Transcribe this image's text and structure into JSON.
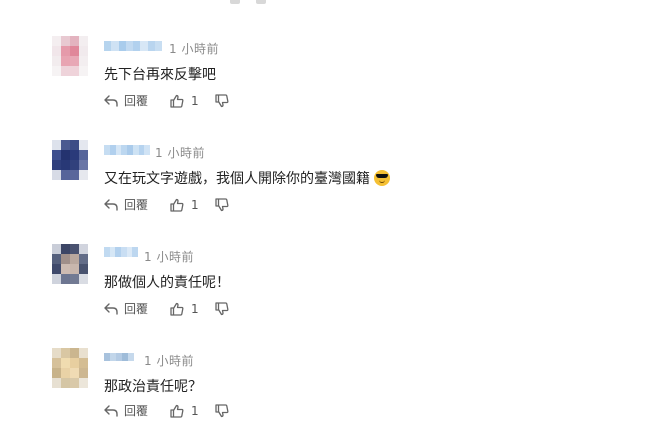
{
  "comments": [
    {
      "time": "1 小時前",
      "text": "先下台再來反擊吧",
      "emoji": "",
      "reply_label": "回覆",
      "like_count": "1",
      "avatar_colors": [
        "#f4eef0",
        "#e8c9d1",
        "#e3b3bf",
        "#f3eef0",
        "#f1e6ea",
        "#e59aaa",
        "#e0879a",
        "#f1eaed",
        "#f2ecee",
        "#e8a4b2",
        "#e8a8b6",
        "#f3eef0",
        "#f6f3f4",
        "#eed3da",
        "#efd3da",
        "#f6f3f4"
      ],
      "name_colors": [
        "#b6d4ee",
        "#cfe2f4",
        "#a9ccec",
        "#c2daf1",
        "#b2d1ee",
        "#d7e7f6",
        "#b9d5ef",
        "#c8def2"
      ]
    },
    {
      "time": "1 小時前",
      "text": "又在玩文字遊戲，我個人開除你的臺灣國籍",
      "emoji": "sunglasses-emoji",
      "reply_label": "回覆",
      "like_count": "1",
      "avatar_colors": [
        "#dde2ec",
        "#4a5a90",
        "#3d4d86",
        "#e4e7ef",
        "#3e4f8e",
        "#24336f",
        "#2a3a7a",
        "#56659a",
        "#2f3f7c",
        "#283876",
        "#31417c",
        "#6a76a6",
        "#d7dbe6",
        "#56649a",
        "#5a679b",
        "#e6e8ee"
      ],
      "name_colors": [
        "#c6ddf2",
        "#b1d0ee",
        "#d5e6f6",
        "#bcd7f0",
        "#aacbeb",
        "#cde2f4",
        "#b6d3ef",
        "#d0e3f5"
      ]
    },
    {
      "time": "1 小時前",
      "text": "那做個人的責任呢！",
      "emoji": "",
      "reply_label": "回覆",
      "like_count": "1",
      "avatar_colors": [
        "#c9cdd8",
        "#3c4566",
        "#4a5270",
        "#d1d4de",
        "#55607d",
        "#a08f8a",
        "#b9a79e",
        "#636d88",
        "#3f4a6c",
        "#cdbbb2",
        "#c8b6ad",
        "#49536f",
        "#cfd3dd",
        "#6d7691",
        "#727a93",
        "#d9dce3"
      ],
      "name_colors": [
        "#c1daf1",
        "#d6e7f6",
        "#b3d1ee",
        "#c9def3",
        "#dbe9f7",
        "#bdd7f0"
      ]
    },
    {
      "time": "1 小時前",
      "text": "那政治責任呢？",
      "emoji": "",
      "reply_label": "回覆",
      "like_count": "1",
      "avatar_colors": [
        "#e6dcc8",
        "#d9c7a3",
        "#cbb68f",
        "#e9e0cf",
        "#d6c19a",
        "#f0dcb0",
        "#e8cfa0",
        "#d4bd93",
        "#c8b38a",
        "#e9d2a6",
        "#f0dbb4",
        "#cdb791",
        "#e7e0d2",
        "#d5c6a5",
        "#d9c9a9",
        "#ece6da"
      ],
      "name_colors": [
        "#a8c2dd",
        "#c2d6ea",
        "#b4cbe4",
        "#9fbcd9",
        "#c6d9ec"
      ]
    }
  ]
}
